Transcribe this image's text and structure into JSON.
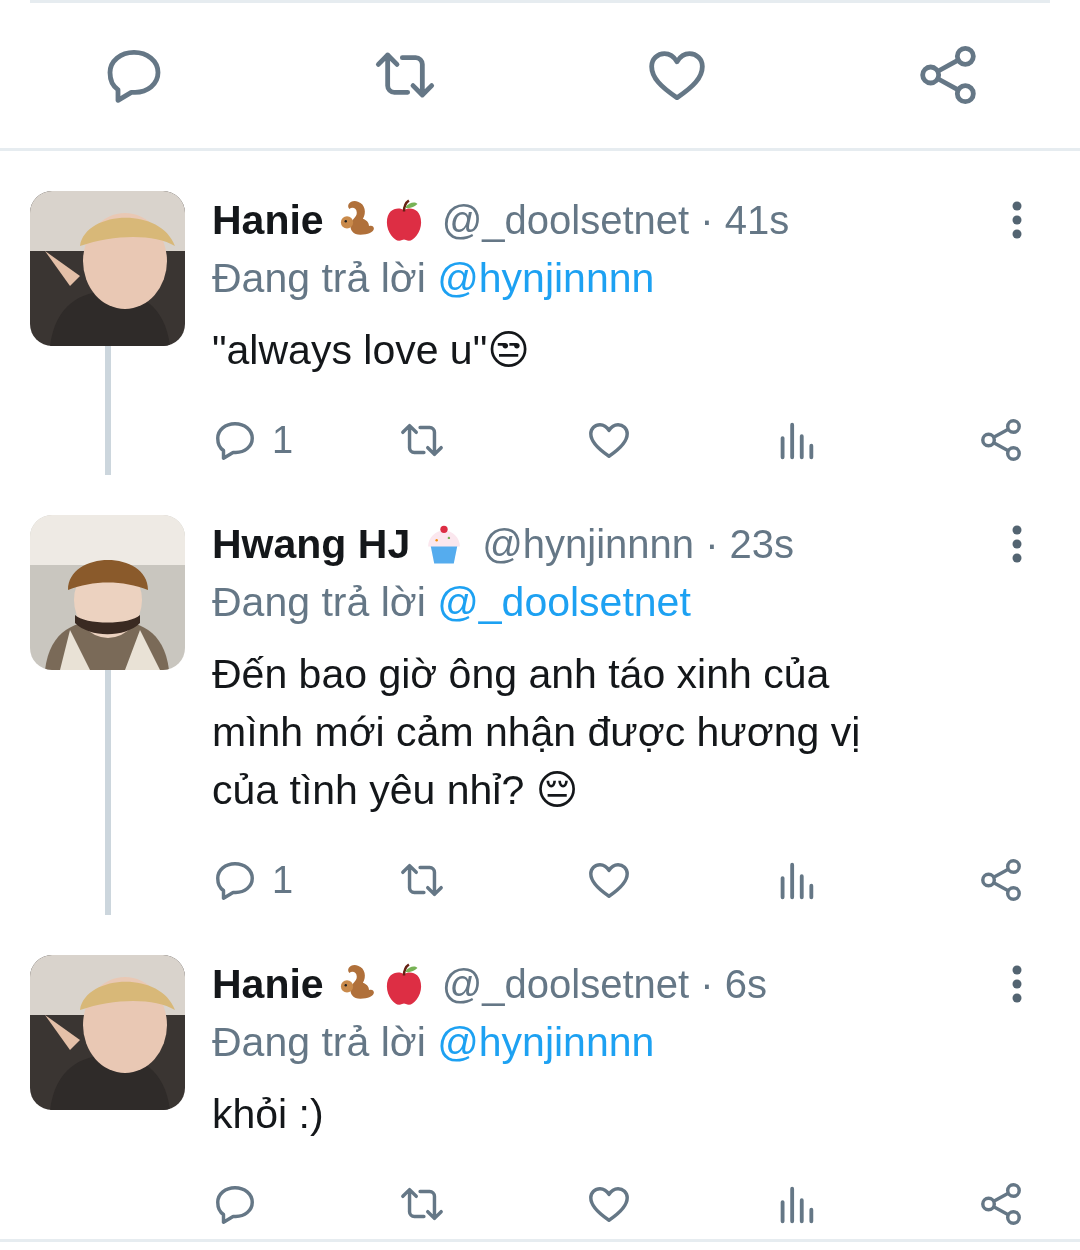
{
  "top_actions": [
    {
      "kind": "reply"
    },
    {
      "kind": "retweet"
    },
    {
      "kind": "like"
    },
    {
      "kind": "share"
    }
  ],
  "tweets": [
    {
      "avatar": {
        "kind": "hood"
      },
      "name": "Hanie",
      "name_emojis": [
        {
          "kind": "squirrel"
        },
        {
          "kind": "apple"
        }
      ],
      "meta": "@_doolsetnet · 41s",
      "reply_prefix": "Đang trả lời",
      "reply_to": "@hynjinnnn",
      "text": "\"always love u\"😒",
      "reply_count": "1",
      "connected_below": true
    },
    {
      "avatar": {
        "kind": "beanie"
      },
      "name": "Hwang HJ",
      "name_emojis": [
        {
          "kind": "cupcake"
        }
      ],
      "meta": "@hynjinnnn · 23s",
      "reply_prefix": "Đang trả lời",
      "reply_to": "@_doolsetnet",
      "text": "Đến bao giờ ông anh táo xinh của mình mới cảm nhận được hương vị của tình yêu nhỉ? 😔",
      "reply_count": "1",
      "connected_below": true
    },
    {
      "avatar": {
        "kind": "hood"
      },
      "name": "Hanie",
      "name_emojis": [
        {
          "kind": "squirrel"
        },
        {
          "kind": "apple"
        }
      ],
      "meta": "@_doolsetnet · 6s",
      "reply_prefix": "Đang trả lời",
      "reply_to": "@hynjinnnn",
      "text": "khỏi :)",
      "connected_below": false
    }
  ]
}
